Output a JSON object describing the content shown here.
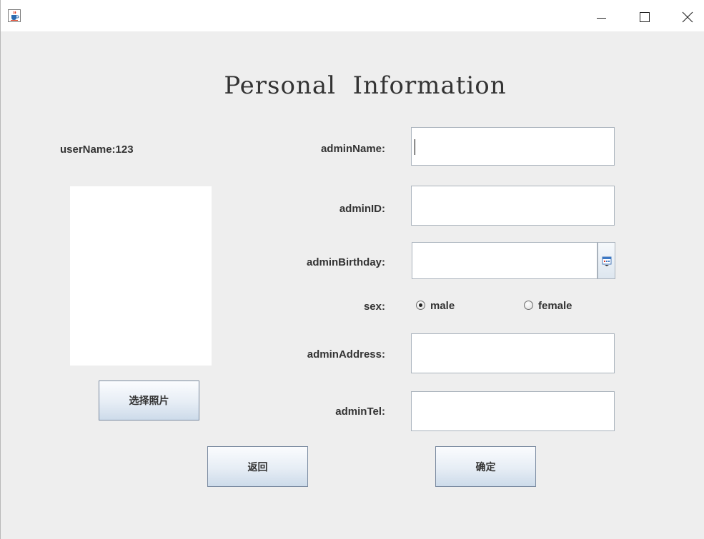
{
  "window": {
    "controls": {
      "minimize": "—",
      "maximize": "☐",
      "close": "✕"
    }
  },
  "form": {
    "heading": "Personal  Information",
    "username_label": "userName:123",
    "labels": {
      "admin_name": "adminName:",
      "admin_id": "adminID:",
      "admin_birthday": "adminBirthday:",
      "sex": "sex:",
      "admin_address": "adminAddress:",
      "admin_tel": "adminTel:"
    },
    "fields": {
      "admin_name": "",
      "admin_id": "",
      "admin_birthday": "",
      "admin_address": "",
      "admin_tel": ""
    },
    "sex_options": [
      {
        "label": "male",
        "selected": true
      },
      {
        "label": "female",
        "selected": false
      }
    ],
    "buttons": {
      "choose_photo": "选择照片",
      "back": "返回",
      "confirm": "确定"
    }
  },
  "icons": {
    "app": "java-cup-icon",
    "calendar": "calendar-icon"
  },
  "colors": {
    "window_bg": "#eeeeee",
    "button_gradient_end": "#cddbea",
    "field_border": "#a9b2bc"
  }
}
